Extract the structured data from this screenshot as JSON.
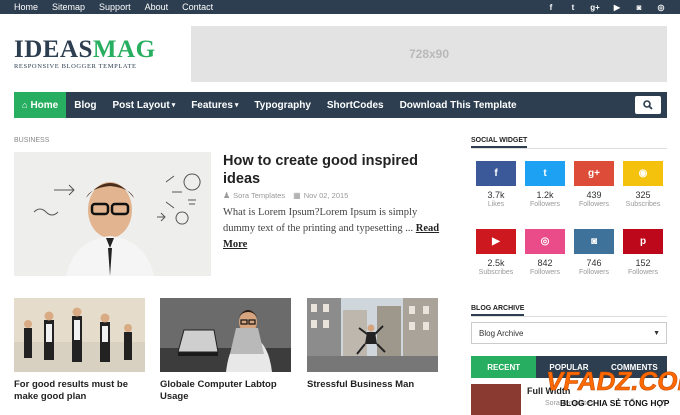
{
  "topbar": {
    "links": [
      "Home",
      "Sitemap",
      "Support",
      "About",
      "Contact"
    ],
    "social_icons": [
      "facebook-icon",
      "twitter-icon",
      "google-plus-icon",
      "youtube-icon",
      "instagram-icon",
      "dribbble-icon"
    ]
  },
  "logo": {
    "name_a": "IDEAS",
    "name_b": "MAG",
    "tagline": "RESPONSIVE BLOGGER TEMPLATE"
  },
  "ad": {
    "label": "728x90"
  },
  "nav": {
    "home": "Home",
    "blog": "Blog",
    "post_layout": "Post Layout",
    "features": "Features",
    "typography": "Typography",
    "shortcodes": "ShortCodes",
    "download": "Download This Template"
  },
  "section": {
    "label": "BUSINESS"
  },
  "featured": {
    "title": "How to create good inspired ideas",
    "author": "Sora Templates",
    "date": "Nov 02, 2015",
    "excerpt": "What is Lorem Ipsum?Lorem Ipsum is simply dummy text of the printing and typesetting ... ",
    "read_more": "Read More"
  },
  "posts": [
    {
      "title": "For good results must be make good plan"
    },
    {
      "title": "Globale Computer Labtop Usage"
    },
    {
      "title": "Stressful Business Man"
    }
  ],
  "sidebar": {
    "social_title": "SOCIAL WIDGET",
    "social": [
      {
        "icon": "f",
        "count": "3.7k",
        "label": "Likes",
        "color": "#3b5998"
      },
      {
        "icon": "t",
        "count": "1.2k",
        "label": "Followers",
        "color": "#1da1f2"
      },
      {
        "icon": "g+",
        "count": "439",
        "label": "Followers",
        "color": "#dd4b39"
      },
      {
        "icon": "rss",
        "count": "325",
        "label": "Subscribes",
        "color": "#f4c20d"
      },
      {
        "icon": "yt",
        "count": "2.5k",
        "label": "Subscribes",
        "color": "#cc181e"
      },
      {
        "icon": "dr",
        "count": "842",
        "label": "Followers",
        "color": "#ea4c89"
      },
      {
        "icon": "ig",
        "count": "746",
        "label": "Followers",
        "color": "#3f729b"
      },
      {
        "icon": "p",
        "count": "152",
        "label": "Followers",
        "color": "#bd081c"
      }
    ],
    "archive_title": "BLOG ARCHIVE",
    "archive_select": "Blog Archive",
    "tabs": [
      "RECENT",
      "POPULAR",
      "COMMENTS"
    ],
    "recent_title": "Full Width",
    "recent_meta": "Sora Templates"
  },
  "watermark": {
    "top": "VFADZ.COM",
    "bottom": "BLOG CHIA SẺ TỔNG HỢP"
  },
  "colors": {
    "dark": "#2c3e50",
    "accent": "#27ae60"
  }
}
